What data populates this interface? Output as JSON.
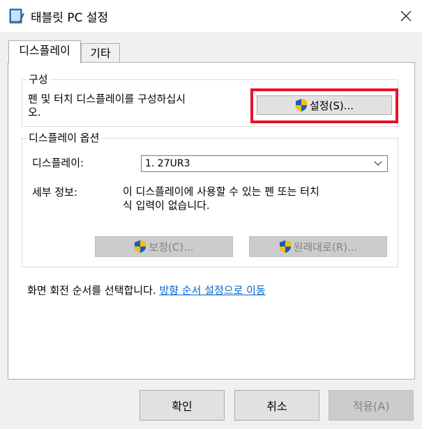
{
  "window": {
    "title": "태블릿 PC 설정",
    "app_icon": "tablet-pc-icon",
    "close_icon": "close-icon"
  },
  "tabs": [
    {
      "label": "디스플레이",
      "selected": true
    },
    {
      "label": "기타",
      "selected": false
    }
  ],
  "config_group": {
    "title": "구성",
    "description": "펜 및 터치 디스플레이를 구성하십시오.",
    "description_line1": "펜 및 터치 디스플레이를 구성하십시",
    "description_line2": "오.",
    "setup_button": "설정(S)...",
    "setup_icon": "uac-shield-icon",
    "highlight_color": "#e8112d"
  },
  "options_group": {
    "title": "디스플레이 옵션",
    "display_label": "디스플레이:",
    "display_value": "1. 27UR3",
    "detail_label": "세부 정보:",
    "detail_line1": "이 디스플레이에 사용할 수 있는 펜 또는 터치",
    "detail_line2": "식 입력이 없습니다.",
    "calibrate_button": "보정(C)...",
    "reset_button": "원래대로(R)..."
  },
  "rotation": {
    "text": "화면 회전 순서를 선택합니다.",
    "link": "방향 순서 설정으로 이동"
  },
  "footer": {
    "ok": "확인",
    "cancel": "취소",
    "apply": "적용(A)"
  },
  "colors": {
    "link": "#0066cc",
    "shield_blue": "#1e5bb8",
    "shield_yellow": "#f5c000"
  }
}
